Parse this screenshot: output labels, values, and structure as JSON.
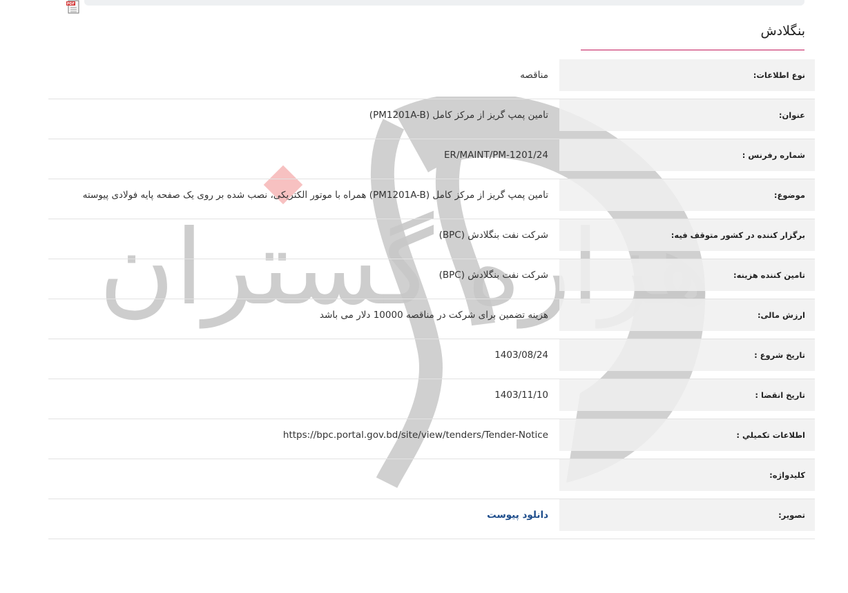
{
  "header": {
    "country": "بنگلادش",
    "pdf_icon": "pdf-file-icon"
  },
  "rows": [
    {
      "label": "نوع اطلاعات:",
      "value": "مناقصه"
    },
    {
      "label": "عنوان:",
      "value": "تامین پمپ گریز از مرکز کامل (PM1201A-B)"
    },
    {
      "label": "شماره رفرنس :",
      "value": "ER/MAINT/PM-1201/24"
    },
    {
      "label": "موضوع:",
      "value": "تامین پمپ گریز از مرکز کامل (PM1201A-B) همراه با موتور الکتریکی، نصب شده بر روی یک صفحه پایه فولادی پیوسته"
    },
    {
      "label": "برگزار کننده در کشور متوقف فیه:",
      "value": "شرکت نفت بنگلادش (BPC)"
    },
    {
      "label": "تامین کننده هزینه:",
      "value": "شرکت نفت بنگلادش (BPC)"
    },
    {
      "label": "ارزش مالی:",
      "value": "هزینه تضمین برای شرکت در مناقصه 10000 دلار می باشد"
    },
    {
      "label": "تاریخ شروع :",
      "value": "1403/08/24"
    },
    {
      "label": "تاریخ انقضا :",
      "value": "1403/11/10"
    },
    {
      "label": "اطلاعات تکمیلي :",
      "value": "https://bpc.portal.gov.bd/site/view/tenders/Tender-Notice"
    },
    {
      "label": "کلیدواژه:",
      "value": ""
    },
    {
      "label": "تصویر:",
      "value": "دانلود پیوست"
    }
  ],
  "watermark_text": "هزاره گستران ارتباط"
}
